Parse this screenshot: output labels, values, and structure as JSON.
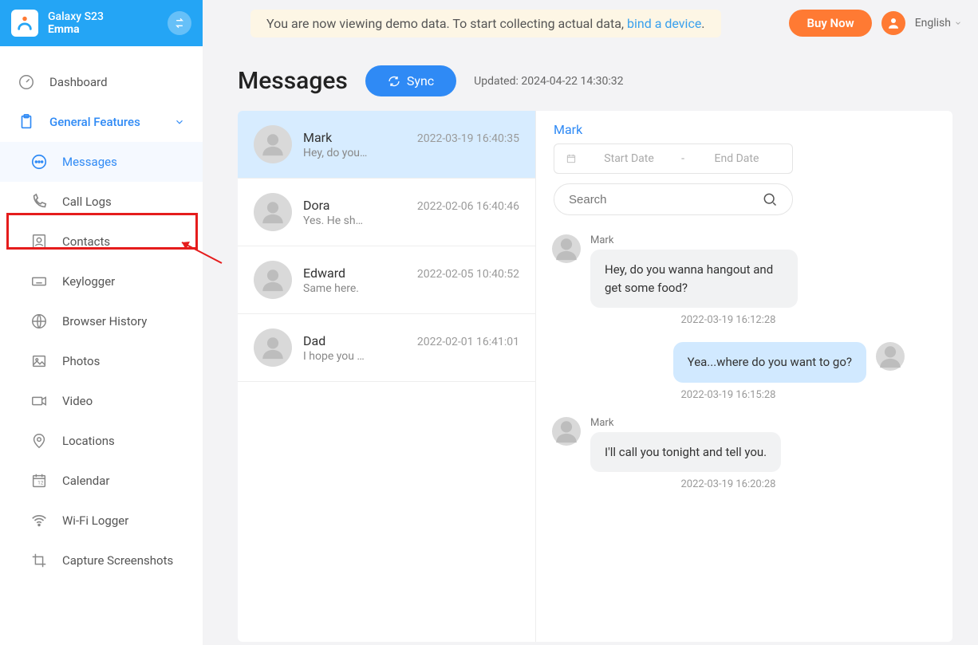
{
  "header": {
    "device": "Galaxy S23",
    "user": "Emma",
    "demo_text_before": "You are now viewing demo data. To start collecting actual data, ",
    "demo_link": "bind a device",
    "demo_text_after": ".",
    "buy_label": "Buy Now",
    "language": "English"
  },
  "sidebar": {
    "dashboard": "Dashboard",
    "section": "General Features",
    "items": [
      {
        "label": "Messages",
        "active": true
      },
      {
        "label": "Call Logs"
      },
      {
        "label": "Contacts"
      },
      {
        "label": "Keylogger"
      },
      {
        "label": "Browser History"
      },
      {
        "label": "Photos"
      },
      {
        "label": "Video"
      },
      {
        "label": "Locations"
      },
      {
        "label": "Calendar"
      },
      {
        "label": "Wi-Fi Logger"
      },
      {
        "label": "Capture Screenshots"
      }
    ]
  },
  "page": {
    "title": "Messages",
    "sync": "Sync",
    "updated": "Updated: 2024-04-22 14:30:32"
  },
  "conversations": [
    {
      "name": "Mark",
      "time": "2022-03-19 16:40:35",
      "preview": "Hey, do you…",
      "active": true
    },
    {
      "name": "Dora",
      "time": "2022-02-06 16:40:46",
      "preview": "Yes. He sh…"
    },
    {
      "name": "Edward",
      "time": "2022-02-05 10:40:52",
      "preview": "Same here."
    },
    {
      "name": "Dad",
      "time": "2022-02-01 16:41:01",
      "preview": "I hope you …"
    }
  ],
  "chat": {
    "contact": "Mark",
    "start_placeholder": "Start Date",
    "dash": "-",
    "end_placeholder": "End Date",
    "search_placeholder": "Search",
    "messages": [
      {
        "dir": "in",
        "sender": "Mark",
        "text": "Hey, do you wanna hangout and get some food?",
        "time": "2022-03-19 16:12:28"
      },
      {
        "dir": "out",
        "text": "Yea...where do you want to go?",
        "time": "2022-03-19 16:15:28"
      },
      {
        "dir": "in",
        "sender": "Mark",
        "text": "I'll call you tonight and tell you.",
        "time": "2022-03-19 16:20:28"
      }
    ]
  }
}
